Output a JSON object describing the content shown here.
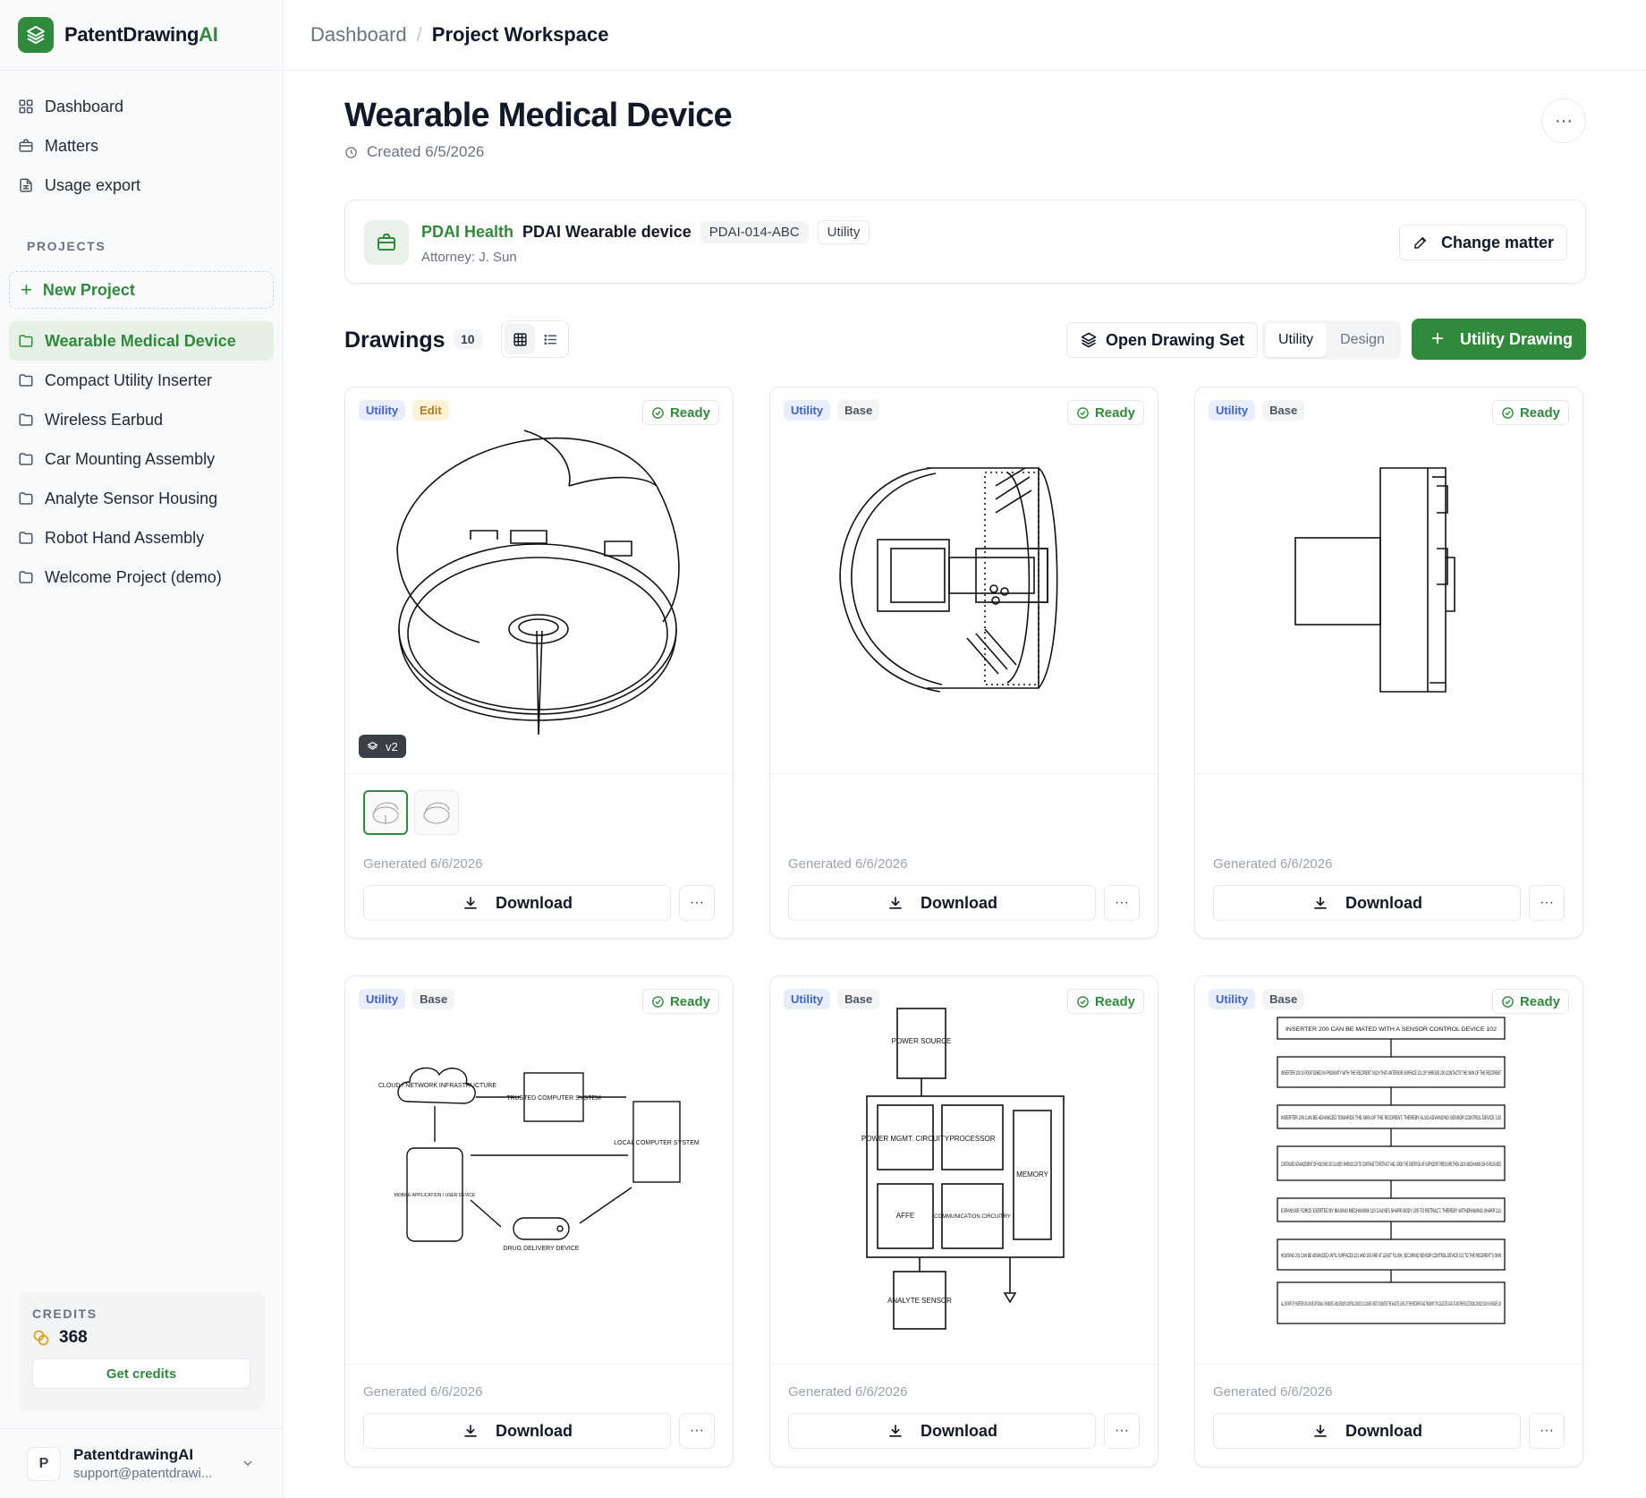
{
  "brand": {
    "name_main": "PatentDrawing",
    "name_accent": "AI"
  },
  "sidebar": {
    "nav": [
      {
        "label": "Dashboard",
        "icon": "grid-icon"
      },
      {
        "label": "Matters",
        "icon": "briefcase-icon"
      },
      {
        "label": "Usage export",
        "icon": "file-sheet-icon"
      }
    ],
    "projects_label": "PROJECTS",
    "new_project": "New Project",
    "projects": [
      "Wearable Medical Device",
      "Compact Utility Inserter",
      "Wireless Earbud",
      "Car Mounting Assembly",
      "Analyte Sensor Housing",
      "Robot Hand Assembly",
      "Welcome Project (demo)"
    ],
    "active_project": "Wearable Medical Device",
    "credits_label": "CREDITS",
    "credits_value": "368",
    "get_credits": "Get credits",
    "user": {
      "initial": "P",
      "name": "PatentdrawingAI",
      "email": "support@patentdrawi..."
    }
  },
  "breadcrumb": {
    "parent": "Dashboard",
    "separator": "/",
    "current": "Project Workspace"
  },
  "header": {
    "title": "Wearable Medical Device",
    "created": "Created 6/5/2026"
  },
  "matter": {
    "client": "PDAI Health",
    "name": "PDAI Wearable device",
    "id": "PDAI-014-ABC",
    "type": "Utility",
    "attorney": "Attorney: J. Sun",
    "change_button": "Change matter"
  },
  "drawings": {
    "title": "Drawings",
    "count": "10",
    "open_set": "Open Drawing Set",
    "segments": [
      "Utility",
      "Design"
    ],
    "active_segment": "Utility",
    "add_button": "Utility Drawing",
    "cards": [
      {
        "badges": [
          "Utility",
          "Edit"
        ],
        "status": "Ready",
        "version": "v2",
        "generated": "Generated 6/6/2026",
        "download": "Download",
        "drawing": "device-perspective"
      },
      {
        "badges": [
          "Utility",
          "Base"
        ],
        "status": "Ready",
        "generated": "Generated 6/6/2026",
        "download": "Download",
        "drawing": "device-section"
      },
      {
        "badges": [
          "Utility",
          "Base"
        ],
        "status": "Ready",
        "generated": "Generated 6/6/2026",
        "download": "Download",
        "drawing": "device-side"
      },
      {
        "badges": [
          "Utility",
          "Base"
        ],
        "status": "Ready",
        "generated": "Generated 6/6/2026",
        "download": "Download",
        "drawing": "network-diagram",
        "labels": [
          "CLOUD / NETWORK INFRASTRUCTURE",
          "TRUSTED COMPUTER SYSTEM",
          "LOCAL COMPUTER SYSTEM",
          "MOBILE APPLICATION / USER DEVICE",
          "DRUG DELIVERY DEVICE"
        ]
      },
      {
        "badges": [
          "Utility",
          "Base"
        ],
        "status": "Ready",
        "generated": "Generated 6/6/2026",
        "download": "Download",
        "drawing": "block-diagram",
        "labels": [
          "POWER SOURCE",
          "POWER MGMT. CIRCUITY",
          "PROCESSOR",
          "MEMORY",
          "AFFE",
          "COMMUNICATION CIRCUITRY",
          "ANALYTE SENSOR"
        ]
      },
      {
        "badges": [
          "Utility",
          "Base"
        ],
        "status": "Ready",
        "generated": "Generated 6/6/2026",
        "download": "Download",
        "drawing": "flowchart",
        "steps": [
          "INSERTER 200 CAN BE MATED WITH A SENSOR CONTROL DEVICE 102",
          "INSERTER 200 IS POSITIONED IN PROXIMITY WITH THE RECIPIENT SUCH THAT ANTERIOR SURFACE 221 OF SHROUD 200 CONTACTS THE SKIN OF THE RECIPIENT",
          "INSERTER 200 CAN BE ADVANCED TOWARDS THE SKIN OF THE RECIPIENT, THEREBY ALSO ADVANCING SENSOR CONTROL DEVICE 102",
          "CONTINUED ADVANCEMENT OF HOUSING 201 CAUSES SHROUD 220 TO CONTINUE TO RETRACT AND, UPON THE EXERTION OF SUFFICIENT PRESSURE THEN LOCK MECHANISM 254 IS RELEASED",
          "EXPANSIVE FORCE EXERTED BY BIASING MECHANISM 215 CAUSES SHARP BODY 205 TO RETRACT, THEREBY WITHDRAWING SHARP 211",
          "HOUSING 201 CAN BE ADVANCED UNTIL SURFACES 221 AND 105 ARE AT LEAST FLUSH, SECURING SENSOR CONTROL DEVICE 102 TO THE RECIPIENT'S SKIN",
          "ALL OR PART OF INSERTER 200 CAN BE OPTIONALLY REMOVED, AND SENSOR CONTROL DEVICE 102 CAN BE USED TO MONITOR THE ANALYTE LEVEL OF THE RECIPIENT AND TRANSMIT ITS COLLECTED DATA TO ANOTHER ELECTRONIC DEVICE SUCH AS READER 120"
        ]
      }
    ]
  },
  "colors": {
    "accent": "#2f8a3b",
    "utility_badge": "#3f63c8",
    "edit_badge": "#b7791f"
  }
}
